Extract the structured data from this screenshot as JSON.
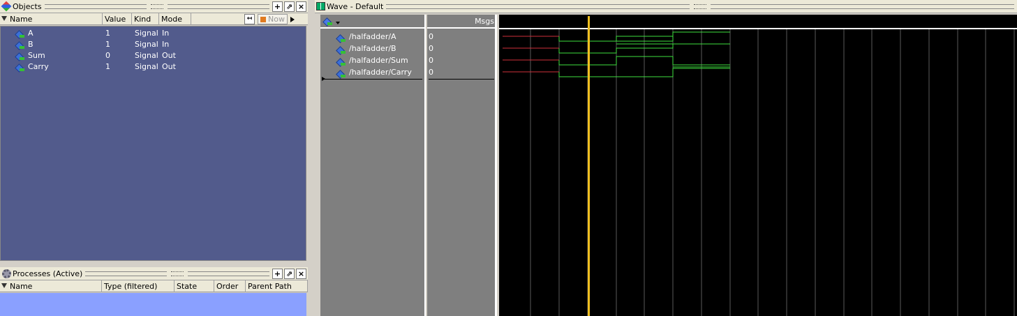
{
  "objects": {
    "title": "Objects",
    "columns": [
      "Name",
      "Value",
      "Kind",
      "Mode"
    ],
    "now_label": "Now",
    "rows": [
      {
        "name": "A",
        "value": "1",
        "kind": "Signal",
        "mode": "In"
      },
      {
        "name": "B",
        "value": "1",
        "kind": "Signal",
        "mode": "In"
      },
      {
        "name": "Sum",
        "value": "0",
        "kind": "Signal",
        "mode": "Out"
      },
      {
        "name": "Carry",
        "value": "1",
        "kind": "Signal",
        "mode": "Out"
      }
    ]
  },
  "processes": {
    "title": "Processes (Active)",
    "columns": [
      "Name",
      "Type (filtered)",
      "State",
      "Order",
      "Parent Path"
    ]
  },
  "wave": {
    "title": "Wave - Default",
    "msgs_label": "Msgs",
    "signals": [
      {
        "path": "/halfadder/A",
        "value": "0"
      },
      {
        "path": "/halfadder/B",
        "value": "0"
      },
      {
        "path": "/halfadder/Sum",
        "value": "0"
      },
      {
        "path": "/halfadder/Carry",
        "value": "0"
      }
    ]
  },
  "colors": {
    "objects_bg": "#525b8c",
    "processes_bg": "#8aa0ff",
    "wave_bg": "#000000",
    "wave_names_bg": "#7f7f7f",
    "signal_x": "#d0303a",
    "signal_green": "#3ee03e",
    "cursor": "#f0c020"
  }
}
